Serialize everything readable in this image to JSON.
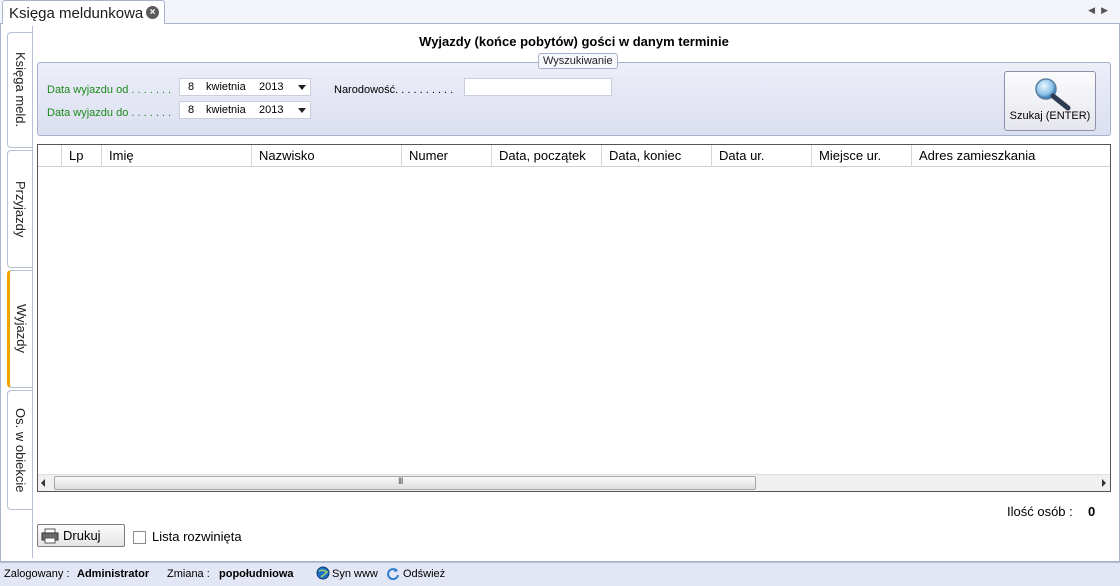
{
  "tab": {
    "title": "Księga meldunkowa"
  },
  "side_tabs": [
    {
      "label": "Księga meld."
    },
    {
      "label": "Przyjazdy"
    },
    {
      "label": "Wyjazdy"
    },
    {
      "label": "Os. w obiekcie"
    }
  ],
  "main": {
    "title": "Wyjazdy (końce pobytów) gości w danym terminie",
    "search": {
      "caption": "Wyszukiwanie",
      "from_label": "Data wyjazdu od . . . . . . .",
      "to_label": "Data wyjazdu do . . . . . . .",
      "from_date": {
        "day": "8",
        "month": "kwietnia",
        "year": "2013"
      },
      "to_date": {
        "day": "8",
        "month": "kwietnia",
        "year": "2013"
      },
      "nationality_label": "Narodowość. . . . . . . . . .",
      "nationality_value": "",
      "button_label": "Szukaj (ENTER)"
    },
    "grid": {
      "columns": [
        "",
        "Lp",
        "Imię",
        "Nazwisko",
        "Numer",
        "Data, początek",
        "Data, koniec",
        "Data ur.",
        "Miejsce ur.",
        "Adres zamieszkania"
      ],
      "rows": [],
      "scroll_grip": "III"
    },
    "count_label": "Ilość osób :",
    "count_value": "0",
    "print_label": "Drukuj",
    "expanded_list_label": "Lista rozwinięta",
    "expanded_list_checked": false
  },
  "statusbar": {
    "logged_label": "Zalogowany :",
    "logged_user": "Administrator",
    "shift_label": "Zmiana :",
    "shift_value": "popołudniowa",
    "sync_label": "Syn www",
    "refresh_label": "Odśwież"
  },
  "colors": {
    "accent_tab": "#f2a300",
    "group_bg": "#dcdff0",
    "green_label": "#1c8a1c"
  }
}
